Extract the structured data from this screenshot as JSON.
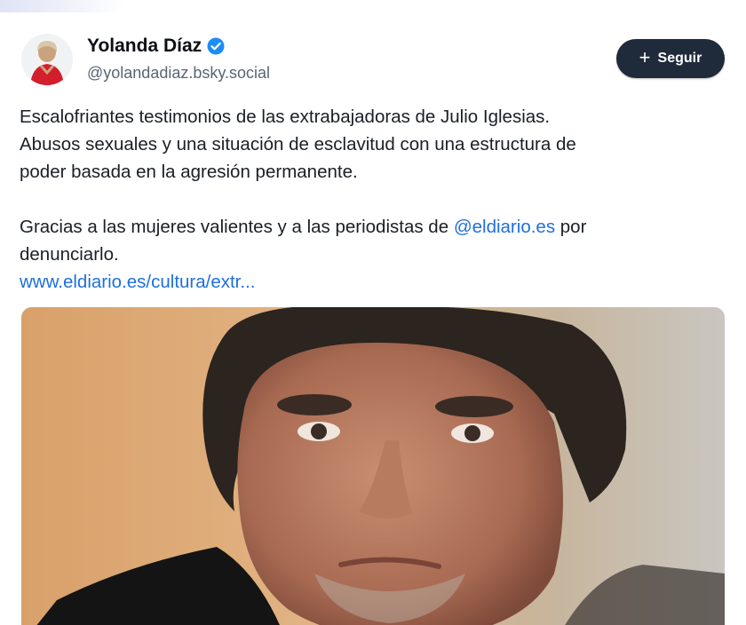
{
  "post": {
    "author_name": "Yolanda Díaz",
    "handle": "@yolandadiaz.bsky.social",
    "follow_label": "Seguir",
    "body": {
      "line1": "Escalofriantes testimonios de las extrabajadoras de Julio Iglesias.",
      "line2": "Abusos sexuales y una situación de esclavitud con una estructura de",
      "line3": "poder basada en la agresión permanente.",
      "line4_prefix": "Gracias a las mujeres valientes y a las periodistas de ",
      "mention": "@eldiario.es",
      "line4_suffix": " por",
      "line5": "denunciarlo.",
      "link": "www.eldiario.es/cultura/extr..."
    }
  },
  "icons": {
    "verified": "verified-badge-icon",
    "follow": "plus-icon"
  },
  "colors": {
    "link": "#1f6fdc",
    "verified": "#1d8cf8",
    "follow_button": "#1f2a3b"
  }
}
